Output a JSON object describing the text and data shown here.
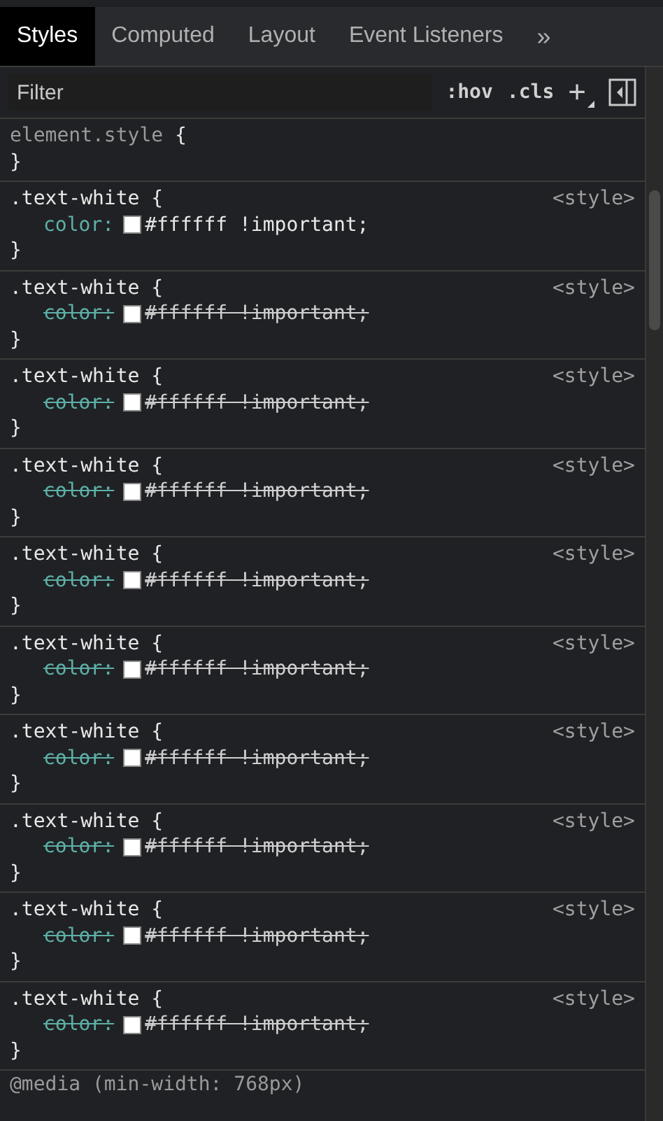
{
  "tabs": [
    {
      "label": "Styles",
      "selected": true
    },
    {
      "label": "Computed",
      "selected": false
    },
    {
      "label": "Layout",
      "selected": false
    },
    {
      "label": "Event Listeners",
      "selected": false
    }
  ],
  "more_tabs": "»",
  "filter": {
    "placeholder": "Filter"
  },
  "toolbar": {
    "hov": ":hov",
    "cls": ".cls",
    "add": "+"
  },
  "element_style": {
    "selector": "element.style",
    "open": "{",
    "close": "}"
  },
  "rules": [
    {
      "selector": ".text-white",
      "open": "{",
      "close": "}",
      "source": "<style>",
      "declarations": [
        {
          "property": "color:",
          "value": "#ffffff !important;",
          "overridden": false
        }
      ]
    },
    {
      "selector": ".text-white",
      "open": "{",
      "close": "}",
      "source": "<style>",
      "declarations": [
        {
          "property": "color:",
          "value": "#ffffff !important;",
          "overridden": true
        }
      ]
    },
    {
      "selector": ".text-white",
      "open": "{",
      "close": "}",
      "source": "<style>",
      "declarations": [
        {
          "property": "color:",
          "value": "#ffffff !important;",
          "overridden": true
        }
      ]
    },
    {
      "selector": ".text-white",
      "open": "{",
      "close": "}",
      "source": "<style>",
      "declarations": [
        {
          "property": "color:",
          "value": "#ffffff !important;",
          "overridden": true
        }
      ]
    },
    {
      "selector": ".text-white",
      "open": "{",
      "close": "}",
      "source": "<style>",
      "declarations": [
        {
          "property": "color:",
          "value": "#ffffff !important;",
          "overridden": true
        }
      ]
    },
    {
      "selector": ".text-white",
      "open": "{",
      "close": "}",
      "source": "<style>",
      "declarations": [
        {
          "property": "color:",
          "value": "#ffffff !important;",
          "overridden": true
        }
      ]
    },
    {
      "selector": ".text-white",
      "open": "{",
      "close": "}",
      "source": "<style>",
      "declarations": [
        {
          "property": "color:",
          "value": "#ffffff !important;",
          "overridden": true
        }
      ]
    },
    {
      "selector": ".text-white",
      "open": "{",
      "close": "}",
      "source": "<style>",
      "declarations": [
        {
          "property": "color:",
          "value": "#ffffff !important;",
          "overridden": true
        }
      ]
    },
    {
      "selector": ".text-white",
      "open": "{",
      "close": "}",
      "source": "<style>",
      "declarations": [
        {
          "property": "color:",
          "value": "#ffffff !important;",
          "overridden": true
        }
      ]
    },
    {
      "selector": ".text-white",
      "open": "{",
      "close": "}",
      "source": "<style>",
      "declarations": [
        {
          "property": "color:",
          "value": "#ffffff !important;",
          "overridden": true
        }
      ]
    }
  ],
  "media_query": "@media (min-width: 768px)"
}
